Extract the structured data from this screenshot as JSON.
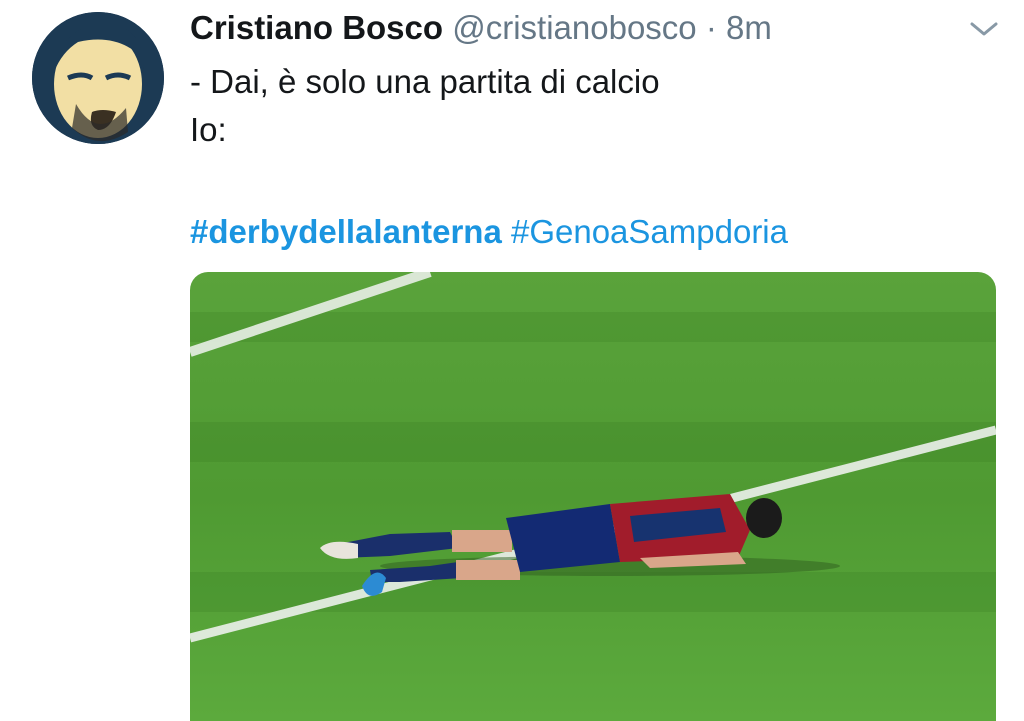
{
  "tweet": {
    "author_name": "Cristiano Bosco",
    "author_handle": "@cristianobosco",
    "separator": " · ",
    "timestamp": "8m",
    "lines": [
      "- Dai, è solo una partita di calcio",
      "Io:"
    ],
    "hashtags": [
      "#derbydellalanterna",
      "#GenoaSampdoria"
    ],
    "menu_icon": "chevron-down-icon",
    "avatar_icon": "avatar",
    "media_description_icon": "photo"
  },
  "colors": {
    "link": "#1b95e0",
    "handle": "#657786",
    "text": "#14171a",
    "pitch": "#4f9a32"
  }
}
